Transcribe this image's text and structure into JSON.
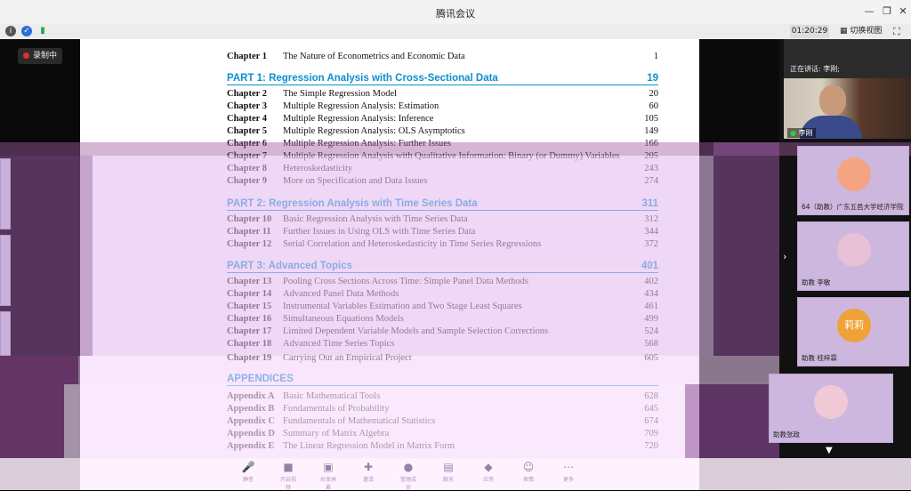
{
  "window": {
    "title": "腾讯会议"
  },
  "topbar": {
    "clock": "01:20:29",
    "switch_view": "切换视图"
  },
  "recording": {
    "label": "录制中"
  },
  "toc": {
    "rows": [
      {
        "ch": "Chapter 1",
        "name": "The Nature of Econometrics and Economic Data",
        "page": "1"
      },
      {
        "part": "PART 1: Regression Analysis with Cross-Sectional Data",
        "page": "19"
      },
      {
        "ch": "Chapter 2",
        "name": "The Simple Regression Model",
        "page": "20"
      },
      {
        "ch": "Chapter 3",
        "name": "Multiple Regression Analysis: Estimation",
        "page": "60"
      },
      {
        "ch": "Chapter 4",
        "name": "Multiple Regression Analysis: Inference",
        "page": "105"
      },
      {
        "ch": "Chapter 5",
        "name": "Multiple Regression Analysis: OLS Asymptotics",
        "page": "149"
      },
      {
        "ch": "Chapter 6",
        "name": "Multiple Regression Analysis: Further Issues",
        "page": "166"
      },
      {
        "ch": "Chapter 7",
        "name": "Multiple Regression Analysis with Qualitative Information: Binary (or Dummy) Variables",
        "page": "205"
      },
      {
        "ch": "Chapter 8",
        "name": "Heteroskedasticity",
        "page": "243"
      },
      {
        "ch": "Chapter 9",
        "name": "More on Specification and Data Issues",
        "page": "274"
      },
      {
        "part": "PART 2: Regression Analysis with Time Series Data",
        "page": "311"
      },
      {
        "ch": "Chapter 10",
        "name": "Basic Regression Analysis with Time Series Data",
        "page": "312"
      },
      {
        "ch": "Chapter 11",
        "name": "Further Issues in Using OLS with Time Series Data",
        "page": "344"
      },
      {
        "ch": "Chapter 12",
        "name": "Serial Correlation and Heteroskedasticity in Time Series Regressions",
        "page": "372"
      },
      {
        "part": "PART 3: Advanced Topics",
        "page": "401"
      },
      {
        "ch": "Chapter 13",
        "name": "Pooling Cross Sections Across Time: Simple Panel Data Methods",
        "page": "402"
      },
      {
        "ch": "Chapter 14",
        "name": "Advanced Panel Data Methods",
        "page": "434"
      },
      {
        "ch": "Chapter 15",
        "name": "Instrumental Variables Estimation and Two Stage Least Squares",
        "page": "461"
      },
      {
        "ch": "Chapter 16",
        "name": "Simultaneous Equations Models",
        "page": "499"
      },
      {
        "ch": "Chapter 17",
        "name": "Limited Dependent Variable Models and Sample Selection Corrections",
        "page": "524"
      },
      {
        "ch": "Chapter 18",
        "name": "Advanced Time Series Topics",
        "page": "568"
      },
      {
        "ch": "Chapter 19",
        "name": "Carrying Out an Empirical Project",
        "page": "605"
      },
      {
        "part": "APPENDICES",
        "page": ""
      },
      {
        "ch": "Appendix A",
        "name": "Basic Mathematical Tools",
        "page": "628"
      },
      {
        "ch": "Appendix B",
        "name": "Fundamentals of Probability",
        "page": "645"
      },
      {
        "ch": "Appendix C",
        "name": "Fundamentals of Mathematical Statistics",
        "page": "674"
      },
      {
        "ch": "Appendix D",
        "name": "Summary of Matrix Algebra",
        "page": "709"
      },
      {
        "ch": "Appendix E",
        "name": "The Linear Regression Model in Matrix Form",
        "page": "720"
      }
    ]
  },
  "speaker": {
    "label": "正在讲话: 李刚;",
    "name": "李刚"
  },
  "participants": [
    {
      "name": "64（助教）广东五邑大学经济学院",
      "color": "#f4a483"
    },
    {
      "name": "助教 李敏",
      "color": "#e7c2d6"
    },
    {
      "name": "助教 桂梓霖",
      "color": "#f0a238",
      "avatar_text": "莉莉"
    },
    {
      "name": "助教张政",
      "color": "#f1c9d6"
    }
  ],
  "toolbar": [
    {
      "icon": "mic-icon",
      "label": "静音"
    },
    {
      "icon": "camera-icon",
      "label": "开启视频"
    },
    {
      "icon": "share-icon",
      "label": "共享屏幕"
    },
    {
      "icon": "invite-icon",
      "label": "邀请"
    },
    {
      "icon": "members-icon",
      "label": "管理成员"
    },
    {
      "icon": "chat-icon",
      "label": "聊天"
    },
    {
      "icon": "app-icon",
      "label": "应用"
    },
    {
      "icon": "emoji-icon",
      "label": "表情"
    },
    {
      "icon": "more-icon",
      "label": "更多"
    }
  ]
}
